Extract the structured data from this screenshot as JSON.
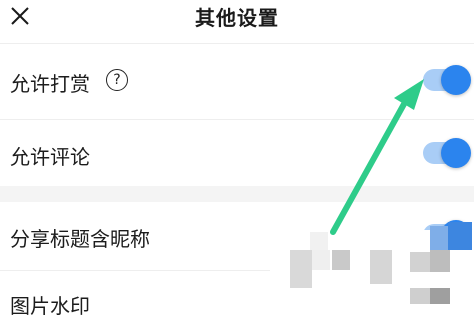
{
  "header": {
    "title": "其他设置",
    "close_icon": "close-icon"
  },
  "settings": [
    {
      "label": "允许打赏",
      "has_help": true,
      "help_glyph": "?",
      "enabled": true
    },
    {
      "label": "允许评论",
      "has_help": false,
      "enabled": true
    },
    {
      "label": "分享标题含昵称",
      "has_help": false,
      "enabled": true
    },
    {
      "label": "图片水印",
      "has_help": false,
      "enabled": true
    }
  ],
  "annotation": {
    "arrow_color": "#2ecc8a",
    "points_to": "允许打赏 toggle"
  },
  "colors": {
    "toggle_track": "#a9cdf6",
    "toggle_knob": "#2b84ee"
  }
}
